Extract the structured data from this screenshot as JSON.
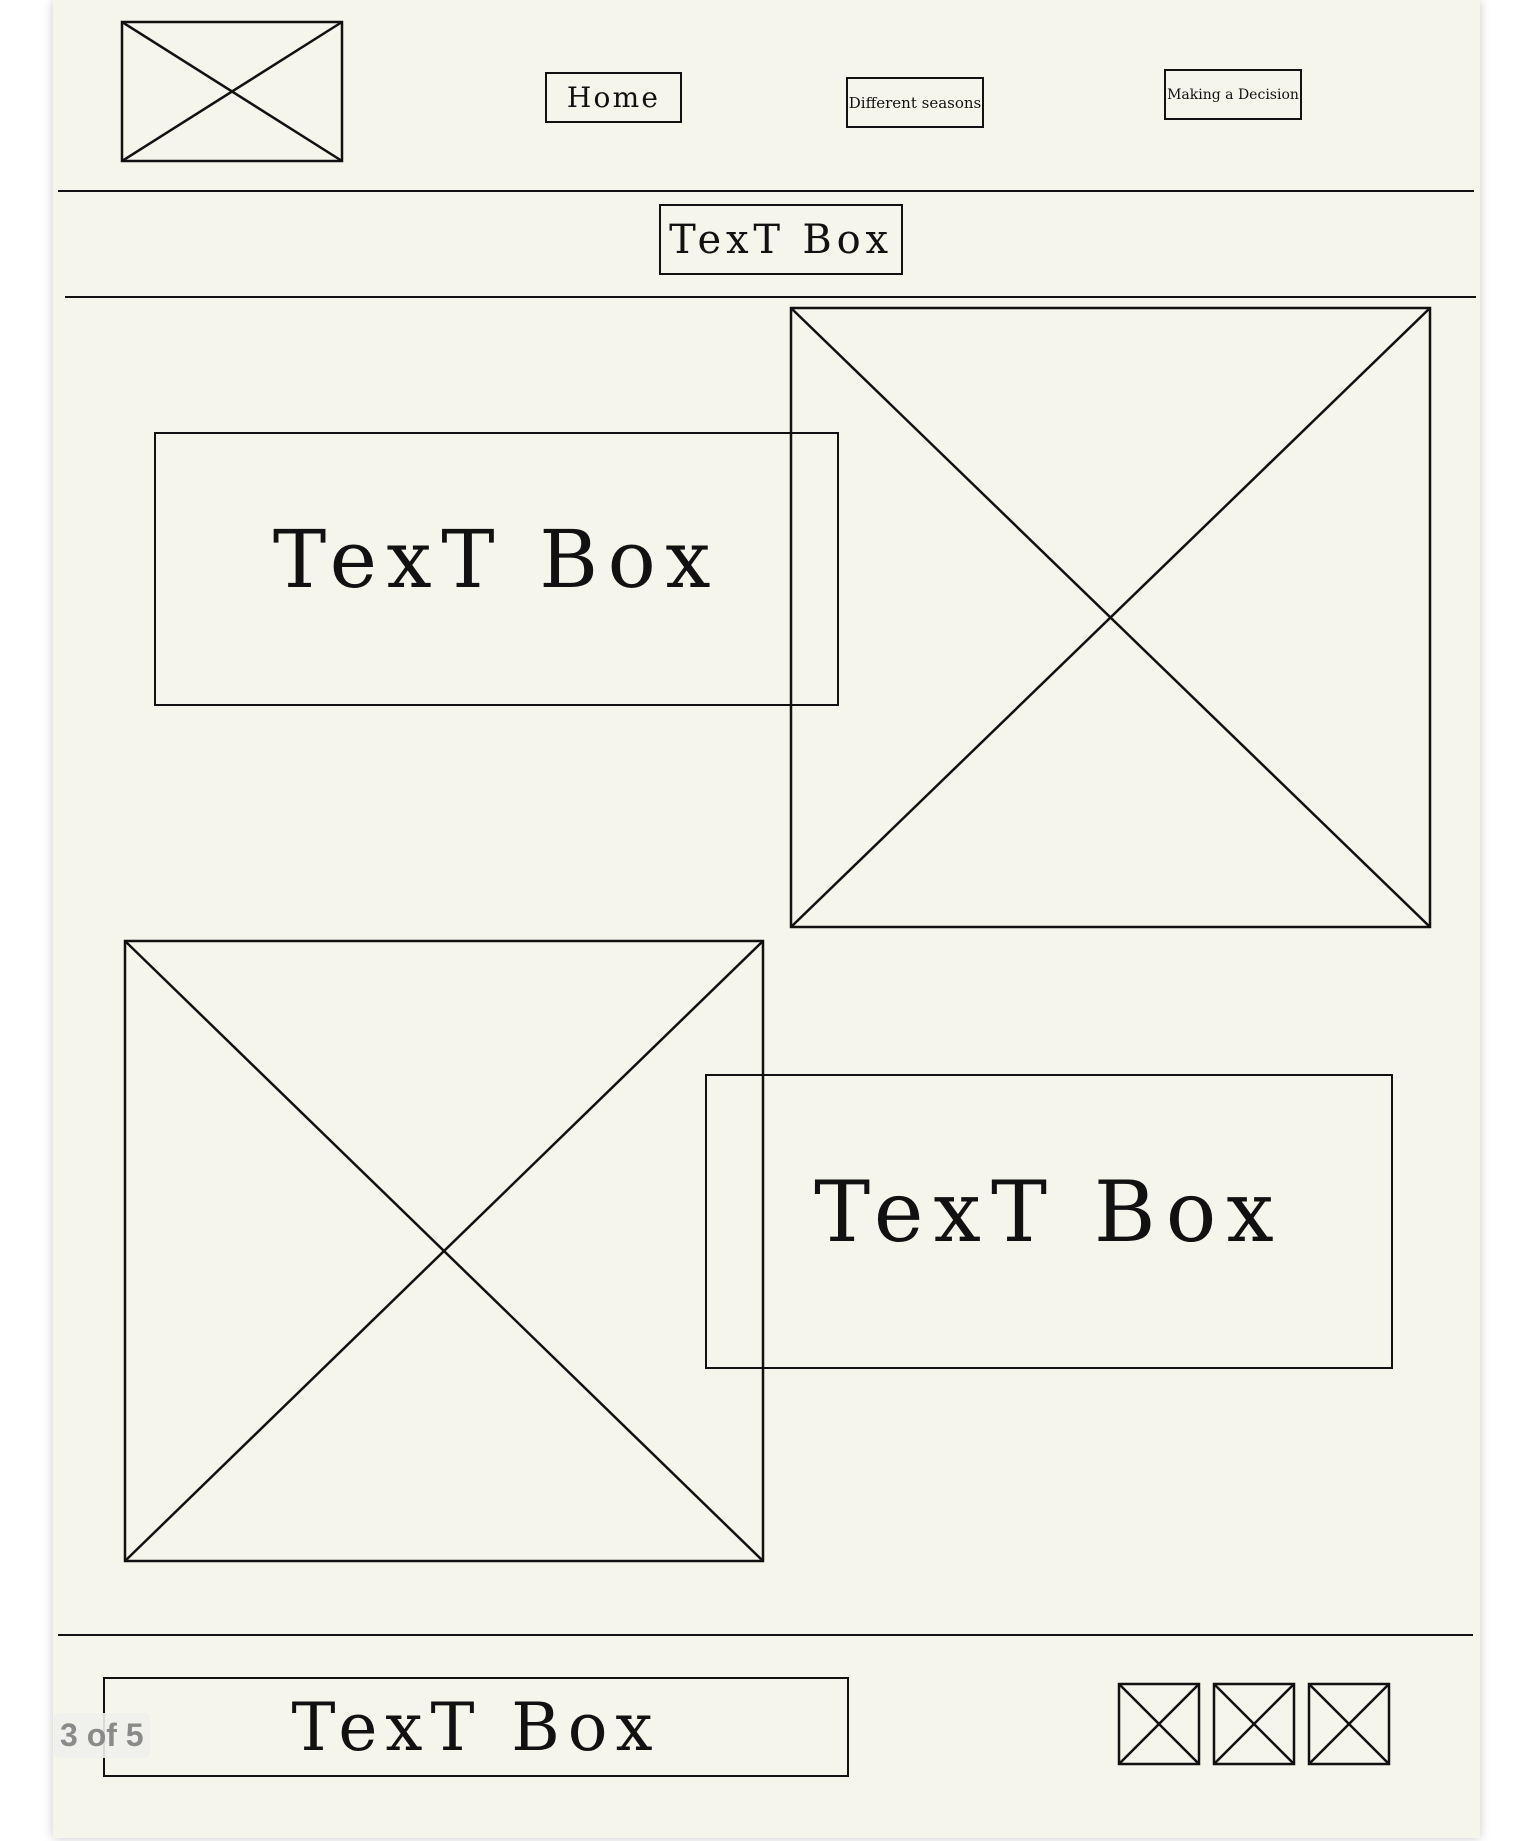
{
  "header": {
    "nav": [
      {
        "label": "Home"
      },
      {
        "label": "Different seasons"
      },
      {
        "label": "Making a Decision"
      }
    ]
  },
  "subheader": {
    "label": "TexT Box"
  },
  "sections": [
    {
      "text": "TexT Box"
    },
    {
      "text": "TexT Box"
    }
  ],
  "footer": {
    "text": "TexT Box"
  },
  "viewer": {
    "page_indicator": "3 of 5"
  }
}
